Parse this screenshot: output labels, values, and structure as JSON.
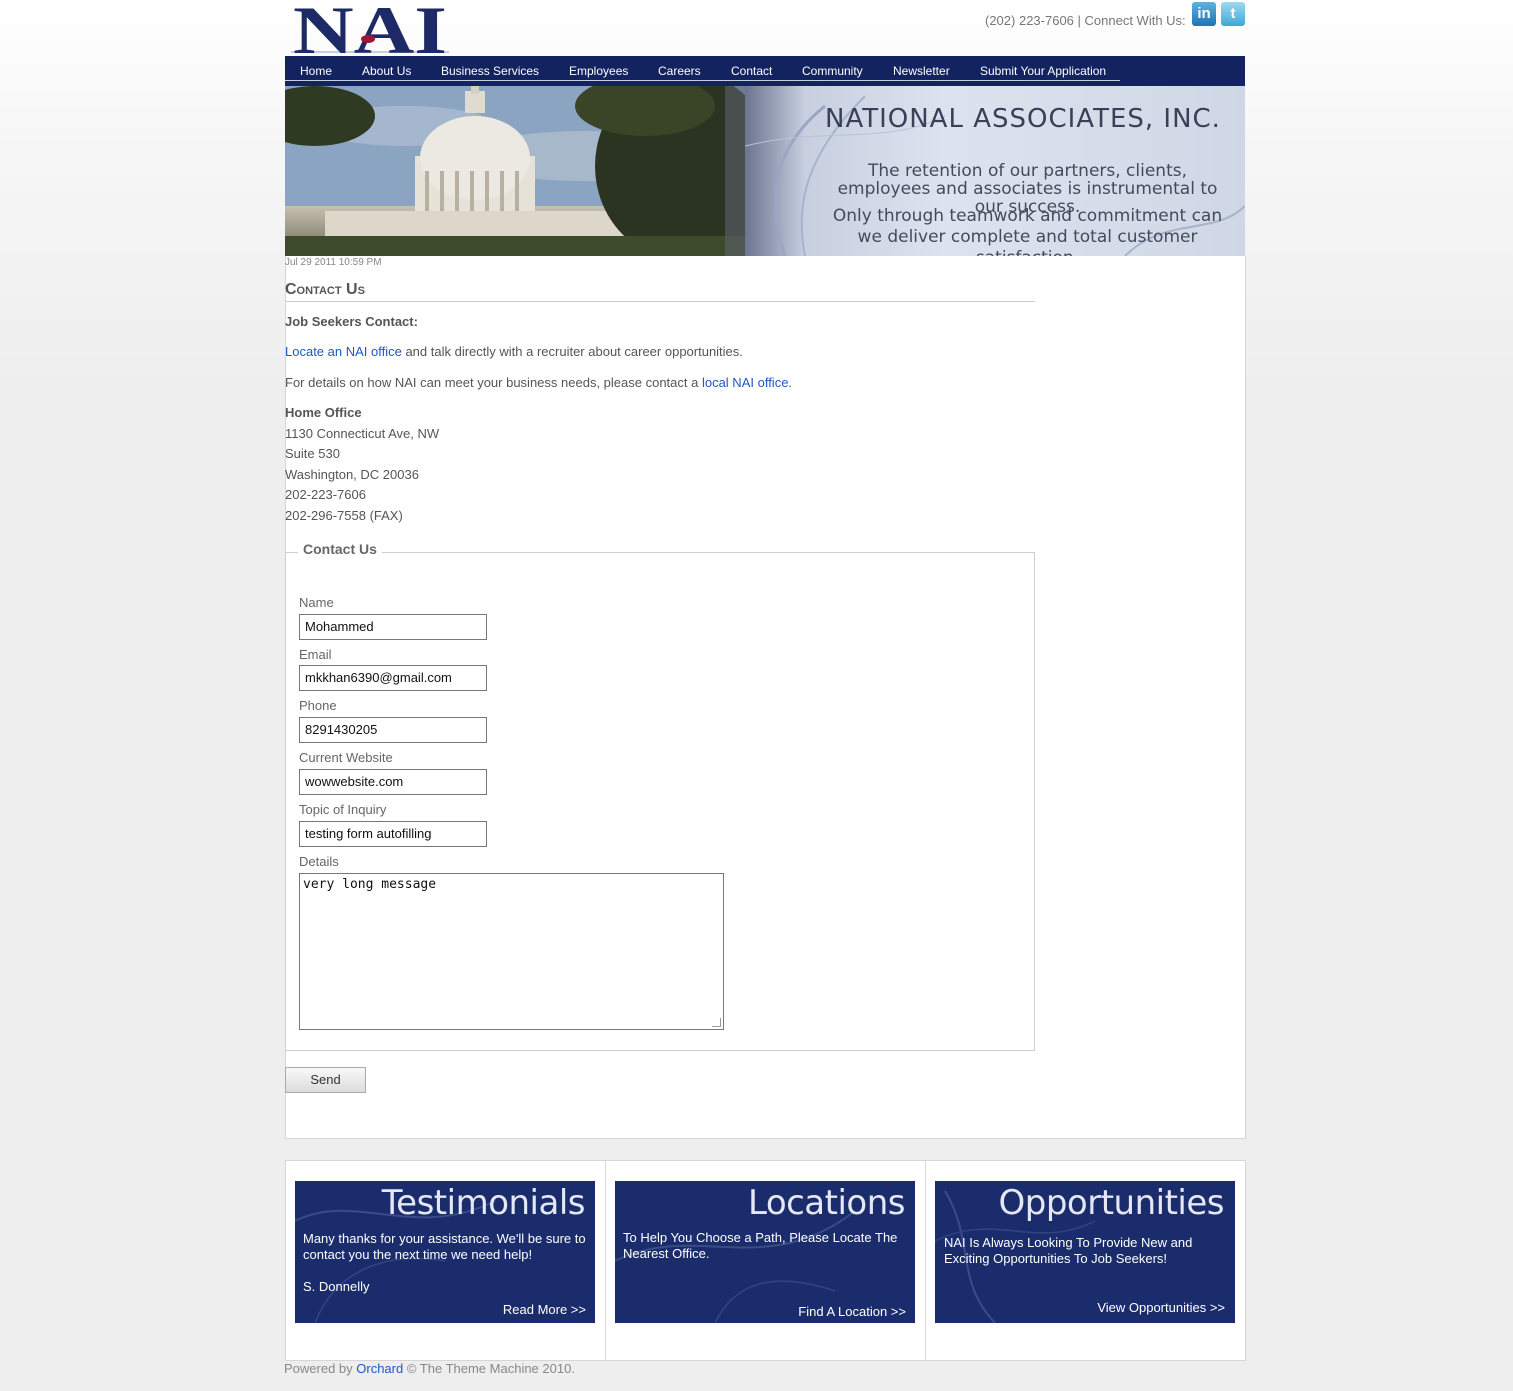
{
  "header": {
    "logo_text": "NAI",
    "phone": "(202) 223-7606",
    "separator": " | ",
    "connect_label": "Connect With Us:",
    "social": [
      {
        "name": "linkedin-icon",
        "glyph": "in"
      },
      {
        "name": "twitter-icon",
        "glyph": "t"
      }
    ]
  },
  "nav": {
    "items": [
      "Home",
      "About Us",
      "Business Services",
      "Employees",
      "Careers",
      "Contact",
      "Community",
      "Newsletter",
      "Submit Your Application"
    ],
    "bg_color": "#13235f"
  },
  "banner": {
    "company": "NATIONAL ASSOCIATES, INC.",
    "tagline_1": "The retention of our partners, clients, employees and associates is instrumental to our success.",
    "tagline_2": "Only through teamwork and commitment can we deliver complete and total customer satisfaction."
  },
  "content": {
    "timestamp": "Jul 29 2011 10:59 PM",
    "title": "Contact Us",
    "job_seekers_heading": "Job Seekers Contact:",
    "locate_link": "Locate an NAI office",
    "locate_rest": " and talk directly with a recruiter about career opportunities.",
    "business_text": "For details on how NAI can meet your business needs, please contact a ",
    "business_link": "local NAI office",
    "business_end": ".",
    "home_office_heading": "Home Office",
    "address": [
      "1130 Connecticut Ave, NW",
      "Suite 530",
      "Washington, DC 20036",
      "202-223-7606",
      "202-296-7558 (FAX)"
    ]
  },
  "form": {
    "legend": "Contact Us",
    "fields": [
      {
        "label": "Name",
        "value": "Mohammed"
      },
      {
        "label": "Email",
        "value": "mkkhan6390@gmail.com"
      },
      {
        "label": "Phone",
        "value": "8291430205"
      },
      {
        "label": "Current Website",
        "value": "wowwebsite.com"
      },
      {
        "label": "Topic of Inquiry",
        "value": "testing form autofilling"
      }
    ],
    "details_label": "Details",
    "details_value": "very long message",
    "send_label": "Send"
  },
  "promos": [
    {
      "title": "Testimonials",
      "text": "Many thanks for your assistance. We'll be sure to contact you the next time we need help!",
      "author": "S. Donnelly",
      "link": "Read More >>"
    },
    {
      "title": "Locations",
      "text": "To Help You Choose a Path, Please Locate The Nearest Office.",
      "link": "Find A Location >>"
    },
    {
      "title": "Opportunities",
      "text": "NAI Is Always Looking To Provide New and Exciting Opportunities To Job Seekers!",
      "link": "View Opportunities >>"
    }
  ],
  "footer": {
    "powered_prefix": "Powered by ",
    "powered_link": "Orchard",
    "powered_suffix": " © The Theme Machine 2010."
  },
  "colors": {
    "link": "#1f57c3",
    "promo_bg": "#1b2c6c"
  }
}
